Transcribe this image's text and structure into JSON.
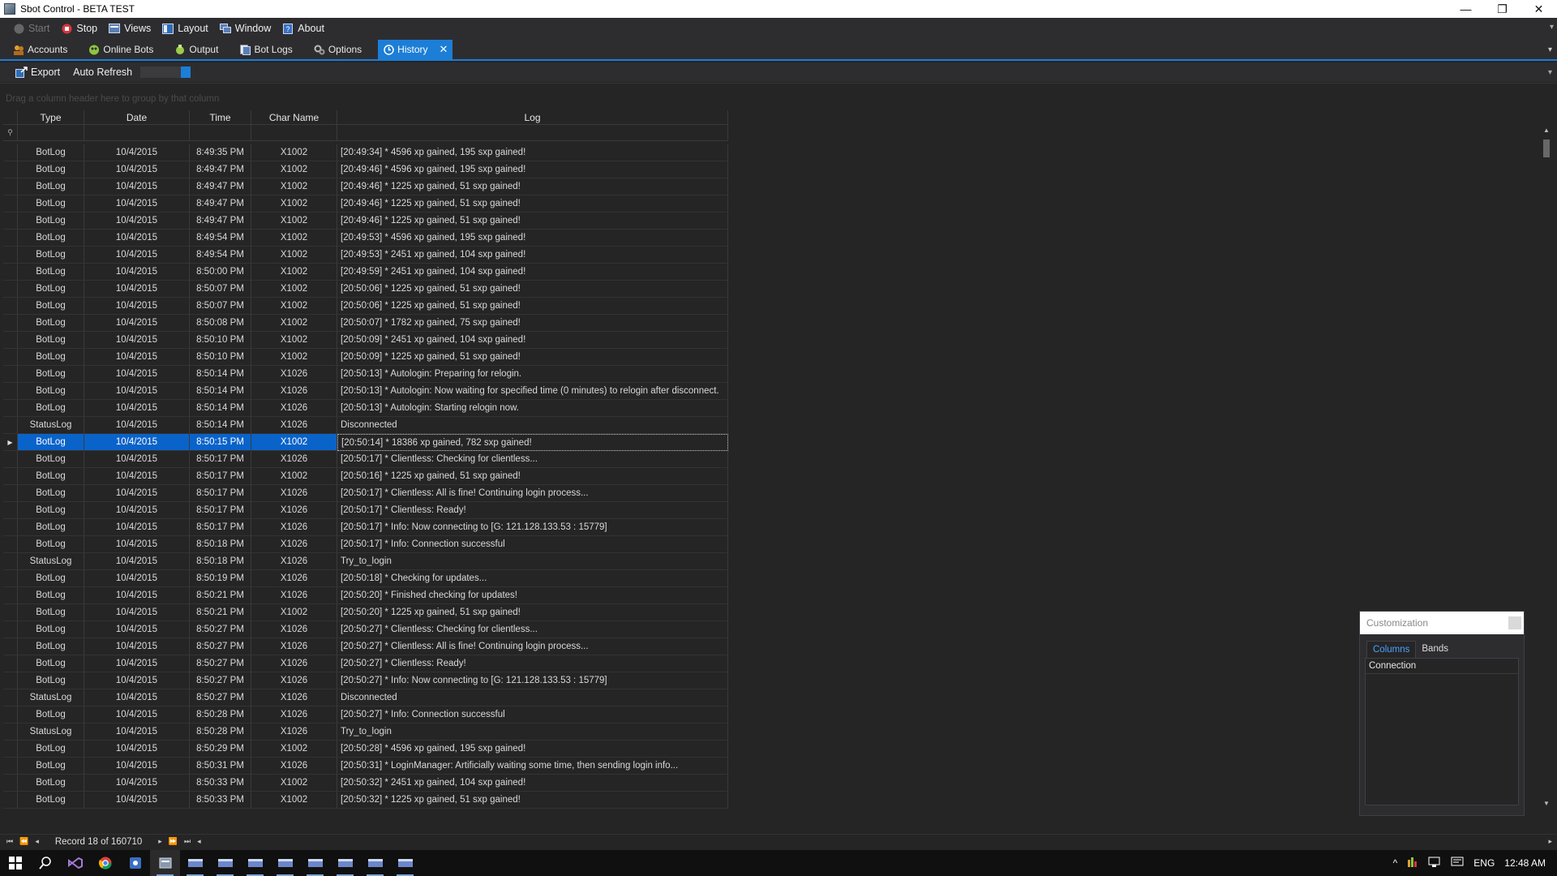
{
  "window": {
    "title": "Sbot Control - BETA TEST",
    "controls": [
      "—",
      "❐",
      "✕"
    ]
  },
  "menu": [
    {
      "label": "Start",
      "icon": "start-icon",
      "disabled": true
    },
    {
      "label": "Stop",
      "icon": "stop-icon",
      "disabled": false
    },
    {
      "label": "Views",
      "icon": "views-icon",
      "disabled": false
    },
    {
      "label": "Layout",
      "icon": "layout-icon",
      "disabled": false
    },
    {
      "label": "Window",
      "icon": "window-icon",
      "disabled": false
    },
    {
      "label": "About",
      "icon": "about-icon",
      "disabled": false
    }
  ],
  "tabs": [
    {
      "label": "Accounts",
      "icon": "accounts-icon"
    },
    {
      "label": "Online Bots",
      "icon": "online-bots-icon"
    },
    {
      "label": "Output",
      "icon": "output-icon"
    },
    {
      "label": "Bot Logs",
      "icon": "bot-logs-icon"
    },
    {
      "label": "Options",
      "icon": "options-icon"
    },
    {
      "label": "History",
      "icon": "history-icon",
      "active": true
    }
  ],
  "toolbar": {
    "export_label": "Export",
    "auto_refresh_label": "Auto Refresh"
  },
  "group_panel": {
    "hint": "Drag a column header here to group by that column"
  },
  "columns": [
    "Type",
    "Date",
    "Time",
    "Char Name",
    "Log"
  ],
  "rows": [
    [
      "BotLog",
      "10/4/2015",
      "8:49:35 PM",
      "X1002",
      "[20:49:34] * 4596 xp gained, 195 sxp gained!"
    ],
    [
      "BotLog",
      "10/4/2015",
      "8:49:47 PM",
      "X1002",
      "[20:49:46] * 4596 xp gained, 195 sxp gained!"
    ],
    [
      "BotLog",
      "10/4/2015",
      "8:49:47 PM",
      "X1002",
      "[20:49:46] * 1225 xp gained, 51 sxp gained!"
    ],
    [
      "BotLog",
      "10/4/2015",
      "8:49:47 PM",
      "X1002",
      "[20:49:46] * 1225 xp gained, 51 sxp gained!"
    ],
    [
      "BotLog",
      "10/4/2015",
      "8:49:47 PM",
      "X1002",
      "[20:49:46] * 1225 xp gained, 51 sxp gained!"
    ],
    [
      "BotLog",
      "10/4/2015",
      "8:49:54 PM",
      "X1002",
      "[20:49:53] * 4596 xp gained, 195 sxp gained!"
    ],
    [
      "BotLog",
      "10/4/2015",
      "8:49:54 PM",
      "X1002",
      "[20:49:53] * 2451 xp gained, 104 sxp gained!"
    ],
    [
      "BotLog",
      "10/4/2015",
      "8:50:00 PM",
      "X1002",
      "[20:49:59] * 2451 xp gained, 104 sxp gained!"
    ],
    [
      "BotLog",
      "10/4/2015",
      "8:50:07 PM",
      "X1002",
      "[20:50:06] * 1225 xp gained, 51 sxp gained!"
    ],
    [
      "BotLog",
      "10/4/2015",
      "8:50:07 PM",
      "X1002",
      "[20:50:06] * 1225 xp gained, 51 sxp gained!"
    ],
    [
      "BotLog",
      "10/4/2015",
      "8:50:08 PM",
      "X1002",
      "[20:50:07] * 1782 xp gained, 75 sxp gained!"
    ],
    [
      "BotLog",
      "10/4/2015",
      "8:50:10 PM",
      "X1002",
      "[20:50:09] * 2451 xp gained, 104 sxp gained!"
    ],
    [
      "BotLog",
      "10/4/2015",
      "8:50:10 PM",
      "X1002",
      "[20:50:09] * 1225 xp gained, 51 sxp gained!"
    ],
    [
      "BotLog",
      "10/4/2015",
      "8:50:14 PM",
      "X1026",
      "[20:50:13] * Autologin: Preparing for relogin."
    ],
    [
      "BotLog",
      "10/4/2015",
      "8:50:14 PM",
      "X1026",
      "[20:50:13] * Autologin: Now waiting for specified time (0 minutes) to relogin after disconnect."
    ],
    [
      "BotLog",
      "10/4/2015",
      "8:50:14 PM",
      "X1026",
      "[20:50:13] * Autologin: Starting relogin now."
    ],
    [
      "StatusLog",
      "10/4/2015",
      "8:50:14 PM",
      "X1026",
      "Disconnected"
    ],
    [
      "BotLog",
      "10/4/2015",
      "8:50:15 PM",
      "X1002",
      "[20:50:14] * 18386 xp gained, 782 sxp gained!"
    ],
    [
      "BotLog",
      "10/4/2015",
      "8:50:17 PM",
      "X1026",
      "[20:50:17] * Clientless: Checking for clientless..."
    ],
    [
      "BotLog",
      "10/4/2015",
      "8:50:17 PM",
      "X1002",
      "[20:50:16] * 1225 xp gained, 51 sxp gained!"
    ],
    [
      "BotLog",
      "10/4/2015",
      "8:50:17 PM",
      "X1026",
      "[20:50:17] * Clientless: All is fine! Continuing login process..."
    ],
    [
      "BotLog",
      "10/4/2015",
      "8:50:17 PM",
      "X1026",
      "[20:50:17] * Clientless: Ready!"
    ],
    [
      "BotLog",
      "10/4/2015",
      "8:50:17 PM",
      "X1026",
      "[20:50:17] * Info: Now connecting to [G: 121.128.133.53 : 15779]"
    ],
    [
      "BotLog",
      "10/4/2015",
      "8:50:18 PM",
      "X1026",
      "[20:50:17] * Info: Connection successful"
    ],
    [
      "StatusLog",
      "10/4/2015",
      "8:50:18 PM",
      "X1026",
      "Try_to_login"
    ],
    [
      "BotLog",
      "10/4/2015",
      "8:50:19 PM",
      "X1026",
      "[20:50:18] * Checking for updates..."
    ],
    [
      "BotLog",
      "10/4/2015",
      "8:50:21 PM",
      "X1026",
      "[20:50:20] * Finished checking for updates!"
    ],
    [
      "BotLog",
      "10/4/2015",
      "8:50:21 PM",
      "X1002",
      "[20:50:20] * 1225 xp gained, 51 sxp gained!"
    ],
    [
      "BotLog",
      "10/4/2015",
      "8:50:27 PM",
      "X1026",
      "[20:50:27] * Clientless: Checking for clientless..."
    ],
    [
      "BotLog",
      "10/4/2015",
      "8:50:27 PM",
      "X1026",
      "[20:50:27] * Clientless: All is fine! Continuing login process..."
    ],
    [
      "BotLog",
      "10/4/2015",
      "8:50:27 PM",
      "X1026",
      "[20:50:27] * Clientless: Ready!"
    ],
    [
      "BotLog",
      "10/4/2015",
      "8:50:27 PM",
      "X1026",
      "[20:50:27] * Info: Now connecting to [G: 121.128.133.53 : 15779]"
    ],
    [
      "StatusLog",
      "10/4/2015",
      "8:50:27 PM",
      "X1026",
      "Disconnected"
    ],
    [
      "BotLog",
      "10/4/2015",
      "8:50:28 PM",
      "X1026",
      "[20:50:27] * Info: Connection successful"
    ],
    [
      "StatusLog",
      "10/4/2015",
      "8:50:28 PM",
      "X1026",
      "Try_to_login"
    ],
    [
      "BotLog",
      "10/4/2015",
      "8:50:29 PM",
      "X1002",
      "[20:50:28] * 4596 xp gained, 195 sxp gained!"
    ],
    [
      "BotLog",
      "10/4/2015",
      "8:50:31 PM",
      "X1026",
      "[20:50:31] * LoginManager: Artificially waiting some time, then sending login info..."
    ],
    [
      "BotLog",
      "10/4/2015",
      "8:50:33 PM",
      "X1002",
      "[20:50:32] * 2451 xp gained, 104 sxp gained!"
    ],
    [
      "BotLog",
      "10/4/2015",
      "8:50:33 PM",
      "X1002",
      "[20:50:32] * 1225 xp gained, 51 sxp gained!"
    ]
  ],
  "selected_row": 17,
  "navigator": {
    "record_text": "Record 18 of 160710"
  },
  "customization": {
    "title": "Customization",
    "tabs": [
      "Columns",
      "Bands"
    ],
    "active_tab": "Columns",
    "items": [
      "Connection"
    ]
  },
  "taskbar": {
    "tray": {
      "language": "ENG",
      "time": "12:48 AM"
    }
  },
  "colors": {
    "accent": "#1c7ed6",
    "background": "#252526",
    "selection": "#0a63c9"
  }
}
